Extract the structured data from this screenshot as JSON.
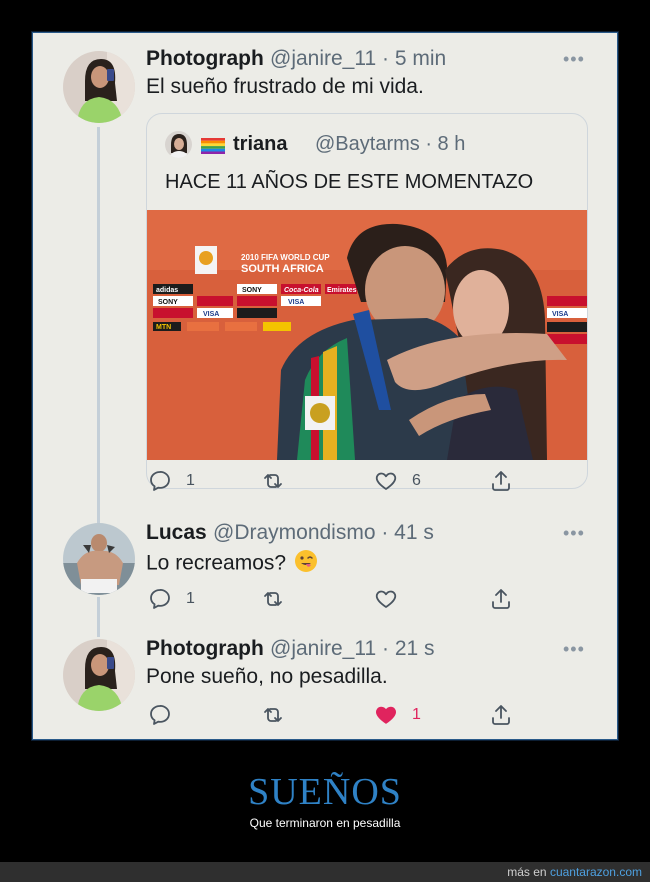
{
  "tweets": [
    {
      "name": "Photograph",
      "handle": "@janire_11 · 5 min",
      "text": "El sueño frustrado de mi vida.",
      "more": "•••",
      "quote": {
        "name": "triana",
        "handle": "@Baytarms · 8 h",
        "text": "HACE 11 AÑOS DE ESTE MOMENTAZO",
        "flag_icon": "rainbow-flag-icon",
        "media": {
          "banner_line1": "2010 FIFA WORLD CUP",
          "banner_line2": "SOUTH AFRICA",
          "sponsors": [
            "adidas",
            "SONY",
            "Coca-Cola",
            "Emirates",
            "VISA",
            "MTN"
          ]
        }
      },
      "actions": {
        "reply_count": "1",
        "retweet_count": "",
        "like_count": "6"
      }
    },
    {
      "name": "Lucas",
      "handle": "@Draymondismo · 41 s",
      "text": "Lo recreamos?",
      "emoji_icon": "winking-tongue-emoji-icon",
      "more": "•••",
      "actions": {
        "reply_count": "1",
        "retweet_count": "",
        "like_count": ""
      }
    },
    {
      "name": "Photograph",
      "handle": "@janire_11 · 21 s",
      "text": "Pone sueño, no pesadilla.",
      "more": "•••",
      "actions": {
        "reply_count": "",
        "retweet_count": "",
        "like_count": "1",
        "liked": true
      }
    }
  ],
  "caption": {
    "title": "SUEÑOS",
    "subtitle": "Que terminaron en pesadilla"
  },
  "footer": {
    "prefix": "más en",
    "link": "cuantarazon.com"
  },
  "colors": {
    "card_bg": "#ecece7",
    "accent_blue": "#2f82c6",
    "like_pink": "#e0245e",
    "text_dark": "#1a1d20",
    "text_muted": "#5d6b78"
  }
}
